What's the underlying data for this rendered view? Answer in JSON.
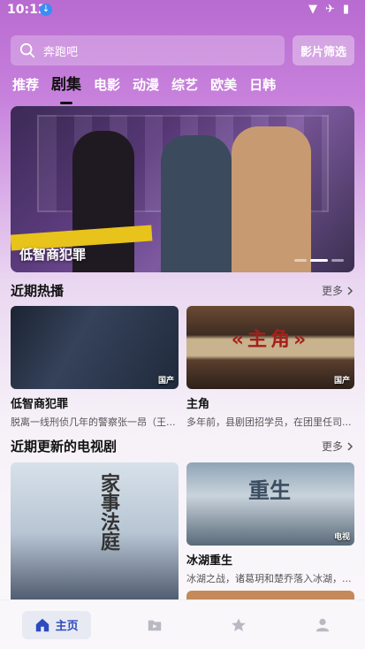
{
  "status": {
    "time": "10:12"
  },
  "search": {
    "placeholder": "奔跑吧",
    "filter_label": "影片筛选"
  },
  "tabs": [
    "推荐",
    "剧集",
    "电影",
    "动漫",
    "综艺",
    "欧美",
    "日韩"
  ],
  "active_tab": "剧集",
  "banner": {
    "title": "低智商犯罪"
  },
  "sections": {
    "hot": {
      "title": "近期热播",
      "more": "更多",
      "items": [
        {
          "title": "低智商犯罪",
          "desc": "脱离一线刑侦几年的警察张一昂（王...",
          "badge": "国产"
        },
        {
          "title": "主角",
          "desc": "多年前，县剧团招学员，在团里任司...",
          "badge": "国产",
          "poster_text": "«主角»"
        }
      ]
    },
    "recent": {
      "title": "近期更新的电视剧",
      "more": "更多",
      "items": [
        {
          "title": "家事法庭",
          "poster_text": "家事法庭"
        },
        {
          "title": "冰湖重生",
          "desc": "冰湖之战，诸葛玥和楚乔落入冰湖，...",
          "badge": "电视",
          "poster_text": "重生"
        }
      ]
    }
  },
  "bottom_nav": [
    {
      "label": "主页",
      "icon": "home-icon",
      "active": true
    },
    {
      "label": "",
      "icon": "folder-icon"
    },
    {
      "label": "",
      "icon": "star-icon"
    },
    {
      "label": "",
      "icon": "user-icon"
    }
  ],
  "colors": {
    "accent": "#2c4bbf",
    "header_gradient": "#b86bd0"
  }
}
